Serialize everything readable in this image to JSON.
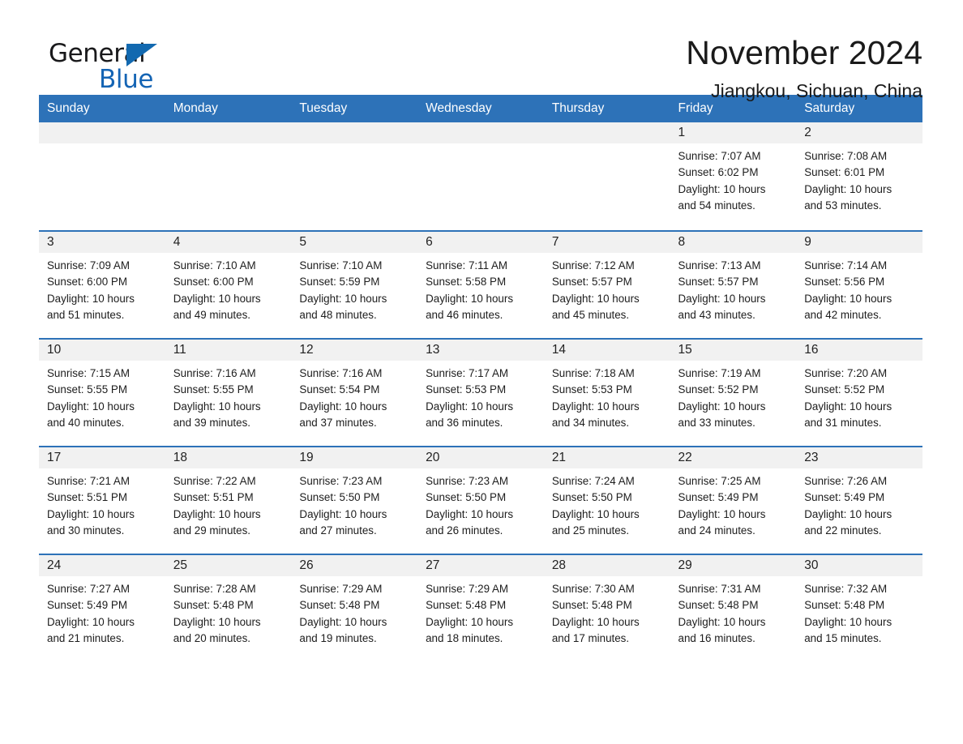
{
  "brand": {
    "name_part1": "General",
    "name_part2": "Blue",
    "triangle_color": "#1269b0",
    "blue_color": "#1464b4"
  },
  "header": {
    "month_title": "November 2024",
    "location": "Jiangkou, Sichuan, China"
  },
  "theme": {
    "header_bg": "#2d72b8",
    "header_text": "#ffffff",
    "daynum_bg": "#f1f1f1",
    "cell_bg": "#ffffff",
    "separator": "#2d72b8"
  },
  "calendar": {
    "weekday_headers": [
      "Sunday",
      "Monday",
      "Tuesday",
      "Wednesday",
      "Thursday",
      "Friday",
      "Saturday"
    ],
    "weeks": [
      [
        {
          "day": "",
          "lines": []
        },
        {
          "day": "",
          "lines": []
        },
        {
          "day": "",
          "lines": []
        },
        {
          "day": "",
          "lines": []
        },
        {
          "day": "",
          "lines": []
        },
        {
          "day": "1",
          "lines": [
            "Sunrise: 7:07 AM",
            "Sunset: 6:02 PM",
            "Daylight: 10 hours",
            "and 54 minutes."
          ]
        },
        {
          "day": "2",
          "lines": [
            "Sunrise: 7:08 AM",
            "Sunset: 6:01 PM",
            "Daylight: 10 hours",
            "and 53 minutes."
          ]
        }
      ],
      [
        {
          "day": "3",
          "lines": [
            "Sunrise: 7:09 AM",
            "Sunset: 6:00 PM",
            "Daylight: 10 hours",
            "and 51 minutes."
          ]
        },
        {
          "day": "4",
          "lines": [
            "Sunrise: 7:10 AM",
            "Sunset: 6:00 PM",
            "Daylight: 10 hours",
            "and 49 minutes."
          ]
        },
        {
          "day": "5",
          "lines": [
            "Sunrise: 7:10 AM",
            "Sunset: 5:59 PM",
            "Daylight: 10 hours",
            "and 48 minutes."
          ]
        },
        {
          "day": "6",
          "lines": [
            "Sunrise: 7:11 AM",
            "Sunset: 5:58 PM",
            "Daylight: 10 hours",
            "and 46 minutes."
          ]
        },
        {
          "day": "7",
          "lines": [
            "Sunrise: 7:12 AM",
            "Sunset: 5:57 PM",
            "Daylight: 10 hours",
            "and 45 minutes."
          ]
        },
        {
          "day": "8",
          "lines": [
            "Sunrise: 7:13 AM",
            "Sunset: 5:57 PM",
            "Daylight: 10 hours",
            "and 43 minutes."
          ]
        },
        {
          "day": "9",
          "lines": [
            "Sunrise: 7:14 AM",
            "Sunset: 5:56 PM",
            "Daylight: 10 hours",
            "and 42 minutes."
          ]
        }
      ],
      [
        {
          "day": "10",
          "lines": [
            "Sunrise: 7:15 AM",
            "Sunset: 5:55 PM",
            "Daylight: 10 hours",
            "and 40 minutes."
          ]
        },
        {
          "day": "11",
          "lines": [
            "Sunrise: 7:16 AM",
            "Sunset: 5:55 PM",
            "Daylight: 10 hours",
            "and 39 minutes."
          ]
        },
        {
          "day": "12",
          "lines": [
            "Sunrise: 7:16 AM",
            "Sunset: 5:54 PM",
            "Daylight: 10 hours",
            "and 37 minutes."
          ]
        },
        {
          "day": "13",
          "lines": [
            "Sunrise: 7:17 AM",
            "Sunset: 5:53 PM",
            "Daylight: 10 hours",
            "and 36 minutes."
          ]
        },
        {
          "day": "14",
          "lines": [
            "Sunrise: 7:18 AM",
            "Sunset: 5:53 PM",
            "Daylight: 10 hours",
            "and 34 minutes."
          ]
        },
        {
          "day": "15",
          "lines": [
            "Sunrise: 7:19 AM",
            "Sunset: 5:52 PM",
            "Daylight: 10 hours",
            "and 33 minutes."
          ]
        },
        {
          "day": "16",
          "lines": [
            "Sunrise: 7:20 AM",
            "Sunset: 5:52 PM",
            "Daylight: 10 hours",
            "and 31 minutes."
          ]
        }
      ],
      [
        {
          "day": "17",
          "lines": [
            "Sunrise: 7:21 AM",
            "Sunset: 5:51 PM",
            "Daylight: 10 hours",
            "and 30 minutes."
          ]
        },
        {
          "day": "18",
          "lines": [
            "Sunrise: 7:22 AM",
            "Sunset: 5:51 PM",
            "Daylight: 10 hours",
            "and 29 minutes."
          ]
        },
        {
          "day": "19",
          "lines": [
            "Sunrise: 7:23 AM",
            "Sunset: 5:50 PM",
            "Daylight: 10 hours",
            "and 27 minutes."
          ]
        },
        {
          "day": "20",
          "lines": [
            "Sunrise: 7:23 AM",
            "Sunset: 5:50 PM",
            "Daylight: 10 hours",
            "and 26 minutes."
          ]
        },
        {
          "day": "21",
          "lines": [
            "Sunrise: 7:24 AM",
            "Sunset: 5:50 PM",
            "Daylight: 10 hours",
            "and 25 minutes."
          ]
        },
        {
          "day": "22",
          "lines": [
            "Sunrise: 7:25 AM",
            "Sunset: 5:49 PM",
            "Daylight: 10 hours",
            "and 24 minutes."
          ]
        },
        {
          "day": "23",
          "lines": [
            "Sunrise: 7:26 AM",
            "Sunset: 5:49 PM",
            "Daylight: 10 hours",
            "and 22 minutes."
          ]
        }
      ],
      [
        {
          "day": "24",
          "lines": [
            "Sunrise: 7:27 AM",
            "Sunset: 5:49 PM",
            "Daylight: 10 hours",
            "and 21 minutes."
          ]
        },
        {
          "day": "25",
          "lines": [
            "Sunrise: 7:28 AM",
            "Sunset: 5:48 PM",
            "Daylight: 10 hours",
            "and 20 minutes."
          ]
        },
        {
          "day": "26",
          "lines": [
            "Sunrise: 7:29 AM",
            "Sunset: 5:48 PM",
            "Daylight: 10 hours",
            "and 19 minutes."
          ]
        },
        {
          "day": "27",
          "lines": [
            "Sunrise: 7:29 AM",
            "Sunset: 5:48 PM",
            "Daylight: 10 hours",
            "and 18 minutes."
          ]
        },
        {
          "day": "28",
          "lines": [
            "Sunrise: 7:30 AM",
            "Sunset: 5:48 PM",
            "Daylight: 10 hours",
            "and 17 minutes."
          ]
        },
        {
          "day": "29",
          "lines": [
            "Sunrise: 7:31 AM",
            "Sunset: 5:48 PM",
            "Daylight: 10 hours",
            "and 16 minutes."
          ]
        },
        {
          "day": "30",
          "lines": [
            "Sunrise: 7:32 AM",
            "Sunset: 5:48 PM",
            "Daylight: 10 hours",
            "and 15 minutes."
          ]
        }
      ]
    ]
  }
}
